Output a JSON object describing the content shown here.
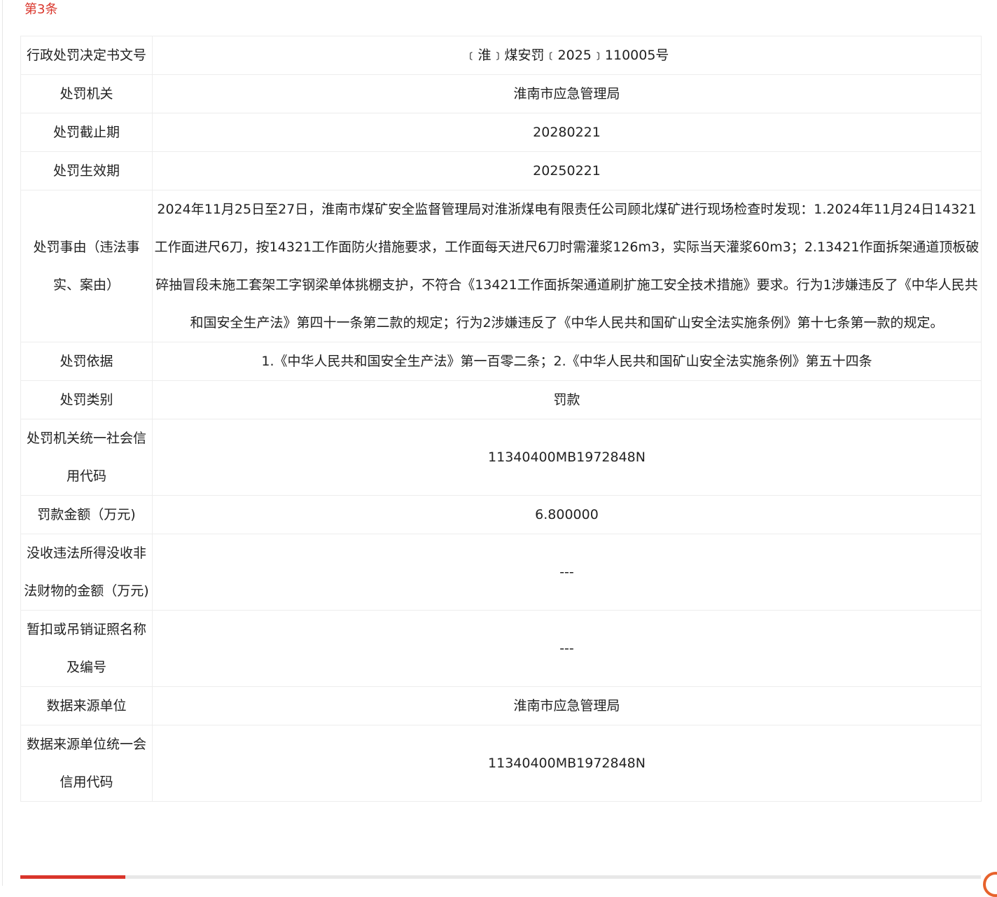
{
  "record_index": "第3条",
  "rows": [
    {
      "label": "行政处罚决定书文号",
      "value": "﹝淮﹞煤安罚﹝2025﹞110005号"
    },
    {
      "label": "处罚机关",
      "value": "淮南市应急管理局"
    },
    {
      "label": "处罚截止期",
      "value": "20280221"
    },
    {
      "label": "处罚生效期",
      "value": "20250221"
    },
    {
      "label": "处罚事由（违法事实、案由）",
      "value": "2024年11月25日至27日，淮南市煤矿安全监督管理局对淮浙煤电有限责任公司顾北煤矿进行现场检查时发现：1.2024年11月24日14321工作面进尺6刀，按14321工作面防火措施要求，工作面每天进尺6刀时需灌浆126m3，实际当天灌浆60m3；2.13421作面拆架通道顶板破碎抽冒段未施工套架工字钢梁单体挑棚支护，不符合《13421工作面拆架通道刷扩施工安全技术措施》要求。行为1涉嫌违反了《中华人民共和国安全生产法》第四十一条第二款的规定；行为2涉嫌违反了《中华人民共和国矿山安全法实施条例》第十七条第一款的规定。"
    },
    {
      "label": "处罚依据",
      "value": "1.《中华人民共和国安全生产法》第一百零二条；2.《中华人民共和国矿山安全法实施条例》第五十四条"
    },
    {
      "label": "处罚类别",
      "value": "罚款"
    },
    {
      "label": "处罚机关统一社会信用代码",
      "value": "11340400MB1972848N"
    },
    {
      "label": "罚款金额（万元)",
      "value": "6.800000"
    },
    {
      "label": "没收违法所得没收非法财物的金额（万元)",
      "value": "---"
    },
    {
      "label": "暂扣或吊销证照名称及编号",
      "value": "---"
    },
    {
      "label": "数据来源单位",
      "value": "淮南市应急管理局"
    },
    {
      "label": "数据来源单位统一会信用代码",
      "value": "11340400MB1972848N"
    }
  ],
  "colors": {
    "accent": "#d9352b",
    "border": "#ededed",
    "text": "#222222"
  }
}
